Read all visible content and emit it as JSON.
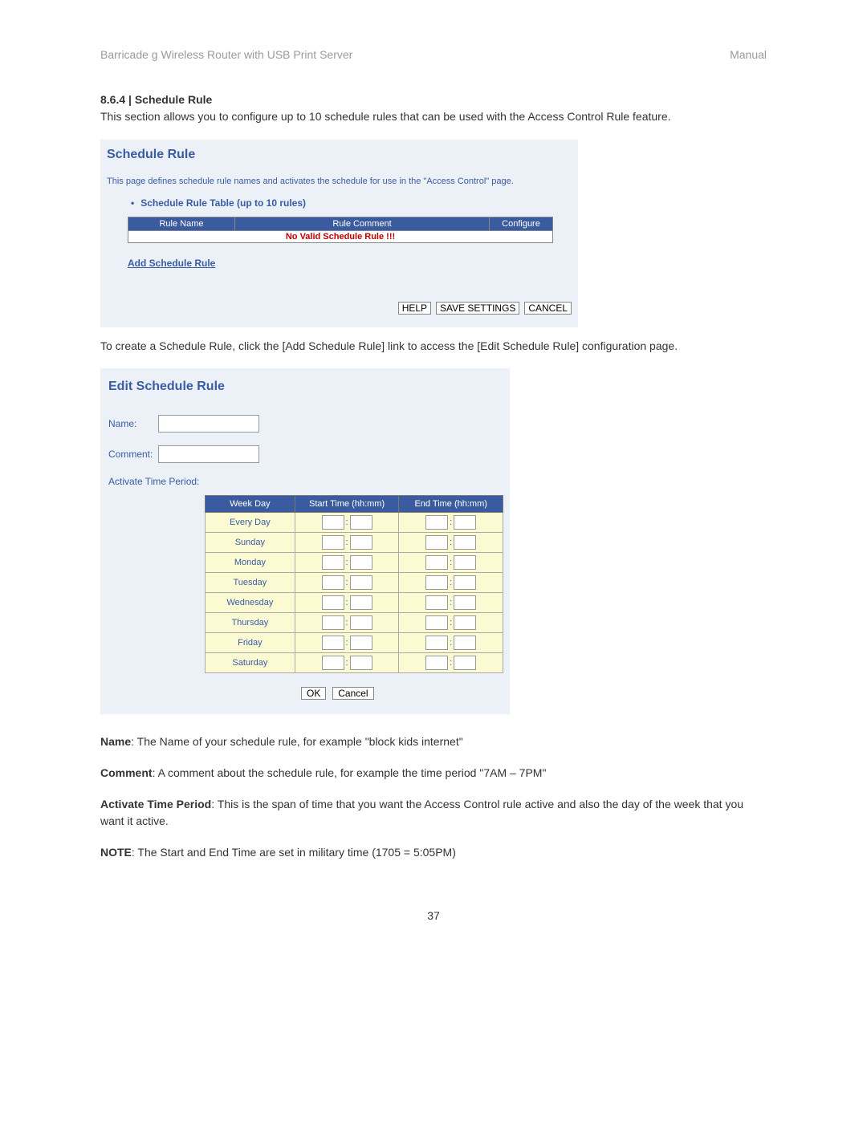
{
  "header": {
    "left": "Barricade g Wireless Router with USB Print Server",
    "right": "Manual"
  },
  "section": {
    "heading": "8.6.4 | Schedule Rule",
    "desc": "This section allows you to configure up to 10 schedule rules that can be used with the Access Control Rule feature."
  },
  "panel1": {
    "title": "Schedule Rule",
    "desc": "This page defines schedule rule names and activates the schedule for use in the \"Access Control\" page.",
    "bullet": "Schedule Rule Table (up to 10 rules)",
    "table": {
      "col_name": "Rule Name",
      "col_comment": "Rule Comment",
      "col_config": "Configure",
      "empty_msg": "No Valid Schedule Rule !!!"
    },
    "add_link": "Add Schedule Rule",
    "btn_help": "HELP",
    "btn_save": "SAVE SETTINGS",
    "btn_cancel": "CANCEL"
  },
  "mid_text": "To create a Schedule Rule, click the [Add Schedule Rule] link to access the [Edit Schedule Rule] configuration page.",
  "panel2": {
    "title": "Edit Schedule Rule",
    "label_name": "Name:",
    "label_comment": "Comment:",
    "label_atp": "Activate Time Period:",
    "table": {
      "col_day": "Week Day",
      "col_start": "Start Time (hh:mm)",
      "col_end": "End Time (hh:mm)",
      "days": [
        "Every Day",
        "Sunday",
        "Monday",
        "Tuesday",
        "Wednesday",
        "Thursday",
        "Friday",
        "Saturday"
      ]
    },
    "btn_ok": "OK",
    "btn_cancel": "Cancel"
  },
  "definitions": {
    "name_b": "Name",
    "name_t": ": The Name of your schedule rule, for example \"block kids internet\"",
    "comment_b": "Comment",
    "comment_t": ": A comment about the schedule rule, for example the time period \"7AM – 7PM\"",
    "atp_b": "Activate Time Period",
    "atp_t": ": This is the span of time that you want the Access Control rule active and also the day of the week that you want it active.",
    "note_b": "NOTE",
    "note_t": ": The Start and End Time are set in military time (1705 = 5:05PM)"
  },
  "page_number": "37"
}
